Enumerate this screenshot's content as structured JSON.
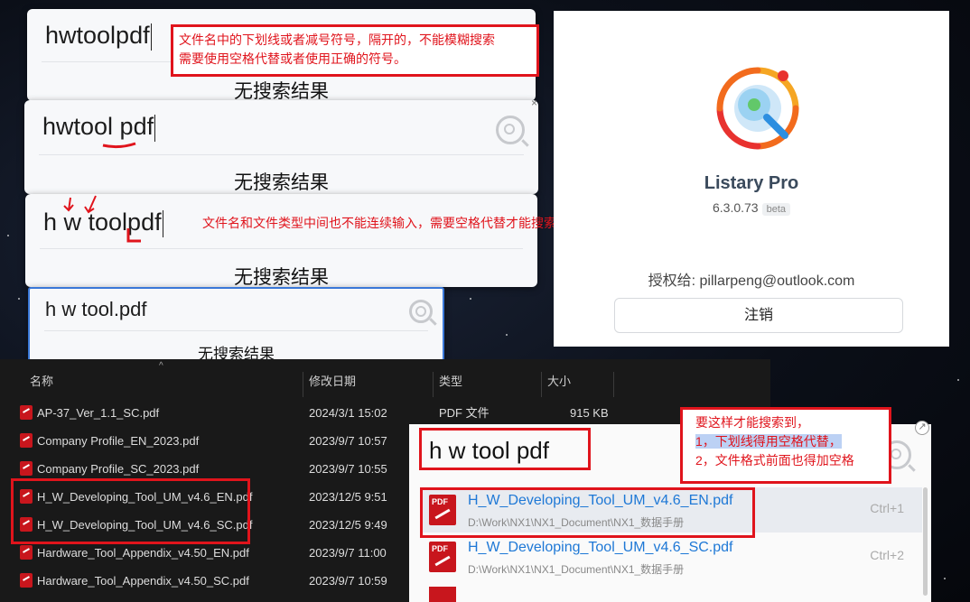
{
  "panels": {
    "p1": {
      "query": "hwtoolpdf",
      "no_result": "无搜索结果"
    },
    "p2": {
      "query": "hwtool pdf",
      "no_result": "无搜索结果"
    },
    "p3": {
      "query": "h w toolpdf",
      "no_result": "无搜索结果"
    },
    "p4": {
      "query": "h w tool.pdf",
      "no_result": "无搜索结果"
    }
  },
  "annotations": {
    "note1_line1": "文件名中的下划线或者减号符号，隔开的，不能模糊搜索",
    "note1_line2": "需要使用空格代替或者使用正确的符号。",
    "note2": "文件名和文件类型中间也不能连续输入，需要空格代替才能搜索到。",
    "note3_line1": "要这样才能搜索到，",
    "note3_line2": "1，下划线得用空格代替，",
    "note3_line3": "2，文件格式前面也得加空格"
  },
  "about": {
    "app_name": "Listary Pro",
    "version": "6.3.0.73",
    "badge": "beta",
    "license": "授权给: pillarpeng@outlook.com",
    "logout_label": "注销"
  },
  "explorer": {
    "columns": [
      "名称",
      "修改日期",
      "类型",
      "大小"
    ],
    "rows": [
      {
        "name": "AP-37_Ver_1.1_SC.pdf",
        "date": "2024/3/1 15:02",
        "type": "PDF 文件",
        "size": "915 KB"
      },
      {
        "name": "Company Profile_EN_2023.pdf",
        "date": "2023/9/7 10:57",
        "type": "",
        "size": ""
      },
      {
        "name": "Company Profile_SC_2023.pdf",
        "date": "2023/9/7 10:55",
        "type": "",
        "size": ""
      },
      {
        "name": "H_W_Developing_Tool_UM_v4.6_EN.pdf",
        "date": "2023/12/5 9:51",
        "type": "",
        "size": ""
      },
      {
        "name": "H_W_Developing_Tool_UM_v4.6_SC.pdf",
        "date": "2023/12/5 9:49",
        "type": "",
        "size": ""
      },
      {
        "name": "Hardware_Tool_Appendix_v4.50_EN.pdf",
        "date": "2023/9/7 11:00",
        "type": "",
        "size": ""
      },
      {
        "name": "Hardware_Tool_Appendix_v4.50_SC.pdf",
        "date": "2023/9/7 10:59",
        "type": "",
        "size": ""
      }
    ]
  },
  "results": {
    "query": "h w tool pdf",
    "items": [
      {
        "name": "H_W_Developing_Tool_UM_v4.6_EN.pdf",
        "path": "D:\\Work\\NX1\\NX1_Document\\NX1_数据手册",
        "hotkey": "Ctrl+1"
      },
      {
        "name": "H_W_Developing_Tool_UM_v4.6_SC.pdf",
        "path": "D:\\Work\\NX1\\NX1_Document\\NX1_数据手册",
        "hotkey": "Ctrl+2"
      }
    ],
    "pdf_label": "PDF"
  },
  "colors": {
    "annotation_red": "#e0141c",
    "link_blue": "#1e78d6",
    "accent_highlight": "#3f7be0"
  }
}
